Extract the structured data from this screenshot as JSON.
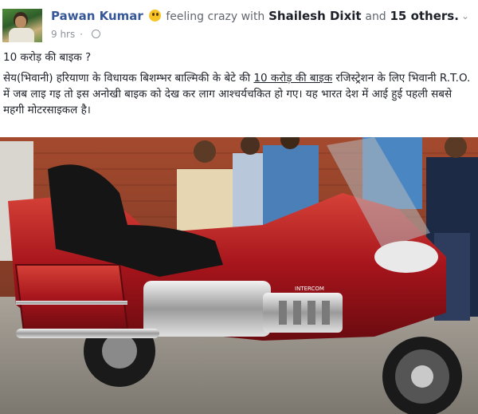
{
  "post": {
    "author": "Pawan Kumar",
    "feeling": "feeling crazy with",
    "tagged_person": "Shailesh Dixit",
    "and_text": "and",
    "others_link": "15 others.",
    "time": "9 hrs",
    "title_line": "10 करोड़ की बाइक ?",
    "body_prefix": "सेय(भिवानी) हरियाणा के विधायक बिशम्भर बाल्मिकी के बेटे की ",
    "body_highlight": "10 करोड़ की बाइक",
    "body_suffix": " रजिस्ट्रेशन के लिए भिवानी R.T.O. में जब लाइ गइ तो इस अनोखी बाइक को देख कर लाग आश्चर्यचकित हो गए। यह भारत देश में आई हुई पहली सबसे महगी मोटरसाइकल है।"
  },
  "photo": {
    "alt": "Red touring motorcycle with onlookers",
    "badge_text": "INTERCOM"
  },
  "icons": {
    "avatar": "profile-photo",
    "emoji": "crazy-face-emoji",
    "privacy": "globe-icon",
    "menu": "chevron-down-icon"
  }
}
